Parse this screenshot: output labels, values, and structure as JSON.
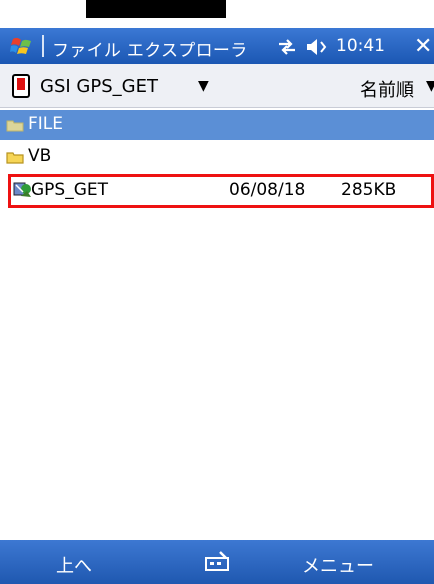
{
  "window": {
    "title": "ファイル エクスプローラ",
    "time": "10:41",
    "close_label": "✕"
  },
  "path_bar": {
    "folder": "GSI GPS_GET",
    "sort": "名前順"
  },
  "files": [
    {
      "name": "FILE",
      "type": "folder",
      "selected": true
    },
    {
      "name": "VB",
      "type": "folder",
      "selected": false
    },
    {
      "name": "GPS_GET",
      "type": "program",
      "date": "06/08/18",
      "size": "285KB",
      "highlighted": true
    }
  ],
  "softkeys": {
    "left": "上へ",
    "right": "メニュー"
  },
  "icons": [
    "windows-logo-icon",
    "connectivity-icon",
    "volume-icon",
    "storage-card-icon",
    "folder-icon",
    "program-icon",
    "keyboard-icon"
  ]
}
